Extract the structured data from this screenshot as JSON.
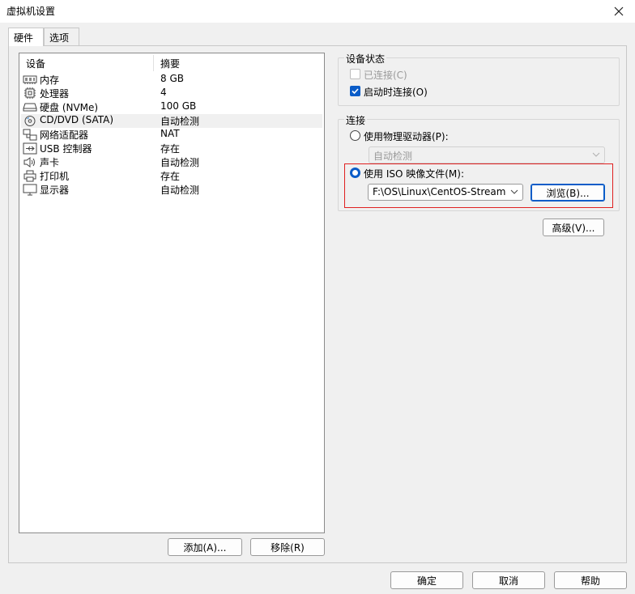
{
  "window": {
    "title": "虚拟机设置"
  },
  "tabs": [
    {
      "label": "硬件"
    },
    {
      "label": "选项"
    }
  ],
  "device_list": {
    "header_device": "设备",
    "header_summary": "摘要",
    "rows": [
      {
        "icon": "memory-icon",
        "name": "内存",
        "summary": "8 GB"
      },
      {
        "icon": "processor-icon",
        "name": "处理器",
        "summary": "4"
      },
      {
        "icon": "hard-disk-icon",
        "name": "硬盘 (NVMe)",
        "summary": "100 GB"
      },
      {
        "icon": "cd-dvd-icon",
        "name": "CD/DVD (SATA)",
        "summary": "自动检测"
      },
      {
        "icon": "network-adapter-icon",
        "name": "网络适配器",
        "summary": "NAT"
      },
      {
        "icon": "usb-icon",
        "name": "USB 控制器",
        "summary": "存在"
      },
      {
        "icon": "sound-card-icon",
        "name": "声卡",
        "summary": "自动检测"
      },
      {
        "icon": "printer-icon",
        "name": "打印机",
        "summary": "存在"
      },
      {
        "icon": "display-icon",
        "name": "显示器",
        "summary": "自动检测"
      }
    ],
    "selected_index": 3
  },
  "buttons": {
    "add": "添加(A)...",
    "remove": "移除(R)",
    "ok": "确定",
    "cancel": "取消",
    "help": "帮助",
    "advanced": "高级(V)...",
    "browse": "浏览(B)..."
  },
  "device_status": {
    "legend": "设备状态",
    "connected_label": "已连接(C)",
    "connected_checked": false,
    "connect_at_power_on_label": "启动时连接(O)",
    "connect_at_power_on_checked": true
  },
  "connection": {
    "legend": "连接",
    "physical_drive_label": "使用物理驱动器(P):",
    "physical_drive_value": "自动检测",
    "iso_label": "使用 ISO 映像文件(M):",
    "iso_path": "F:\\OS\\Linux\\CentOS-Stream",
    "selected": "iso"
  },
  "colors": {
    "accent": "#0a5cc8",
    "highlight_border": "#e02020"
  }
}
